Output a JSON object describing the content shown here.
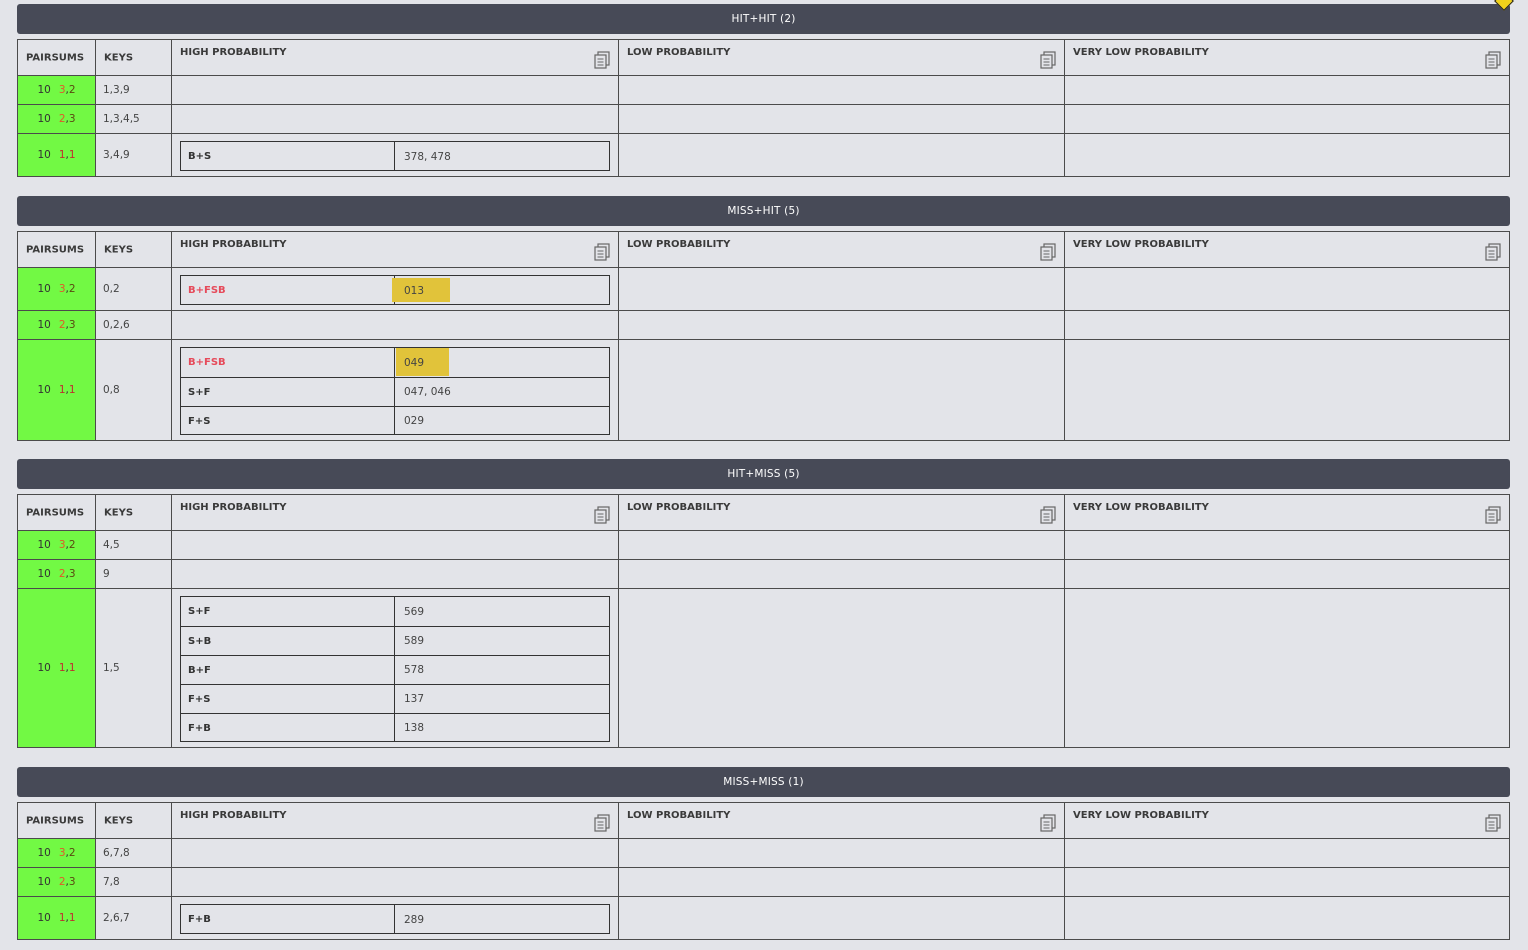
{
  "icons": {
    "copy": "copy-icon",
    "marker": "diamond-marker-icon"
  },
  "colors": {
    "pairsum_bg": "#72f944",
    "header_bg": "#474a57",
    "highlight": "#e1c33a",
    "alert_label": "#e64a5a"
  },
  "columns": {
    "pairsums": "PAIRSUMS",
    "keys": "KEYS",
    "high": "HIGH PROBABILITY",
    "low": "LOW PROBABILITY",
    "very_low": "VERY LOW PROBABILITY"
  },
  "sections": [
    {
      "title": "HIT+HIT (2)",
      "rows": [
        {
          "sum": "10",
          "d1": "3",
          "d2": "2",
          "keys": "1,3,9",
          "high": []
        },
        {
          "sum": "10",
          "d1": "2",
          "d2": "3",
          "keys": "1,3,4,5",
          "high": []
        },
        {
          "sum": "10",
          "d1": "1",
          "d2": "1",
          "keys": "3,4,9",
          "high": [
            {
              "label": "B+S",
              "value": "378, 478"
            }
          ]
        }
      ]
    },
    {
      "title": "MISS+HIT (5)",
      "rows": [
        {
          "sum": "10",
          "d1": "3",
          "d2": "2",
          "keys": "0,2",
          "high": [
            {
              "label": "B+FSB",
              "value": "013",
              "alert": true,
              "highlight": true
            }
          ]
        },
        {
          "sum": "10",
          "d1": "2",
          "d2": "3",
          "keys": "0,2,6",
          "high": []
        },
        {
          "sum": "10",
          "d1": "1",
          "d2": "1",
          "keys": "0,8",
          "high": [
            {
              "label": "B+FSB",
              "value": "049",
              "alert": true,
              "highlight": true
            },
            {
              "label": "S+F",
              "value": "047, 046"
            },
            {
              "label": "F+S",
              "value": "029"
            }
          ]
        }
      ]
    },
    {
      "title": "HIT+MISS (5)",
      "rows": [
        {
          "sum": "10",
          "d1": "3",
          "d2": "2",
          "keys": "4,5",
          "high": []
        },
        {
          "sum": "10",
          "d1": "2",
          "d2": "3",
          "keys": "9",
          "high": []
        },
        {
          "sum": "10",
          "d1": "1",
          "d2": "1",
          "keys": "1,5",
          "high": [
            {
              "label": "S+F",
              "value": "569"
            },
            {
              "label": "S+B",
              "value": "589"
            },
            {
              "label": "B+F",
              "value": "578"
            },
            {
              "label": "F+S",
              "value": "137"
            },
            {
              "label": "F+B",
              "value": "138"
            }
          ]
        }
      ]
    },
    {
      "title": "MISS+MISS (1)",
      "rows": [
        {
          "sum": "10",
          "d1": "3",
          "d2": "2",
          "keys": "6,7,8",
          "high": []
        },
        {
          "sum": "10",
          "d1": "2",
          "d2": "3",
          "keys": "7,8",
          "high": []
        },
        {
          "sum": "10",
          "d1": "1",
          "d2": "1",
          "keys": "2,6,7",
          "high": [
            {
              "label": "F+B",
              "value": "289"
            }
          ]
        }
      ]
    }
  ]
}
